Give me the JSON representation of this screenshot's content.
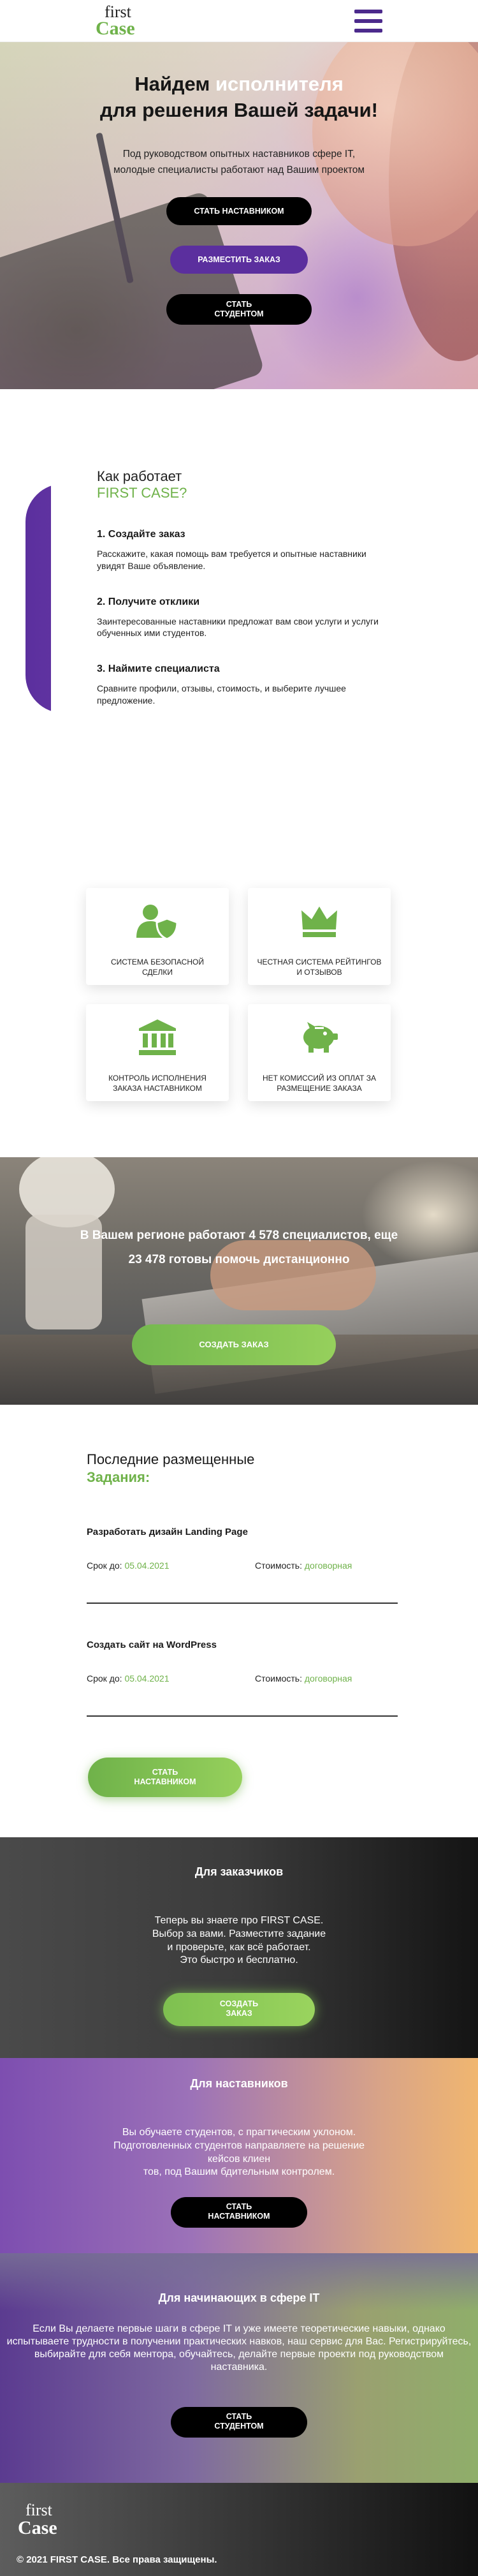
{
  "header": {
    "logo_line1": "first",
    "logo_line2": "Case"
  },
  "hero": {
    "title_part1": "Найдем ",
    "title_highlight": "исполнителя",
    "title_part2": " для решения Вашей задачи!",
    "subtitle": "Под руководством опытных наставников сфере IT, молодые специалисты работают над Вашим проектом",
    "btn_mentor": "СТАТЬ НАСТАВНИКОМ",
    "btn_order": "РАЗМЕСТИТЬ ЗАКАЗ",
    "btn_student_1": "СТАТЬ",
    "btn_student_2": "СТУДЕНТОМ"
  },
  "how": {
    "title": "Как работает",
    "title_brand": "FIRST CASE?",
    "steps": [
      {
        "title": "1. Создайте заказ",
        "text": "Расскажите, какая помощь вам требуется и опытные наставники увидят Ваше объявление."
      },
      {
        "title": "2. Получите отклики",
        "text": "Заинтересованные наставники предложат вам свои услуги и услуги обученных ими студентов."
      },
      {
        "title": "3. Наймите специалиста",
        "text": "Сравните профили, отзывы, стоимость, и выберите лучшее предложение."
      }
    ]
  },
  "features": [
    {
      "label": "СИСТЕМА БЕЗОПАСНОЙ СДЕЛКИ",
      "icon": "user-shield-icon"
    },
    {
      "label": "ЧЕСТНАЯ СИСТЕМА РЕЙТИНГОВ И ОТЗЫВОВ",
      "icon": "crown-icon"
    },
    {
      "label": "КОНТРОЛЬ ИСПОЛНЕНИЯ ЗАКАЗА НАСТАВНИКОМ",
      "icon": "bank-icon"
    },
    {
      "label": "НЕТ КОМИССИЙ ИЗ ОПЛАТ ЗА РАЗМЕЩЕНИЕ ЗАКАЗА",
      "icon": "piggy-bank-icon"
    }
  ],
  "stats": {
    "line1": "В Вашем регионе работают 4 578 специалистов, еще",
    "line2": "23 478 готовы помочь дистанционно",
    "cta": "СОЗДАТЬ ЗАКАЗ"
  },
  "tasks": {
    "title": "Последние размещенные",
    "title_green": "Задания:",
    "items": [
      {
        "title": "Разработать дизайн Landing Page",
        "deadline_label": "Срок до: ",
        "deadline": "05.04.2021",
        "cost_label": "Стоимость: ",
        "cost": "договорная"
      },
      {
        "title": "Создать сайт на WordPress",
        "deadline_label": "Срок до: ",
        "deadline": "05.04.2021",
        "cost_label": "Стоимость: ",
        "cost": "договорная"
      }
    ],
    "cta_1": "СТАТЬ",
    "cta_2": "НАСТАВНИКОМ"
  },
  "customers": {
    "title": "Для заказчиков",
    "lines": [
      "Теперь вы знаете про FIRST CASE.",
      "Выбор за вами. Разместите задание",
      "и проверьте, как всё работает.",
      "Это быстро и бесплатно."
    ],
    "cta_1": "СОЗДАТЬ",
    "cta_2": "ЗАКАЗ"
  },
  "mentors": {
    "title": "Для наставников",
    "lines": [
      "Вы обучаете студентов, с прагтическим уклоном.",
      "Подготовленных студентов направляете на решение",
      "кейсов клиен",
      "тов, под Вашим бдительным контролем."
    ],
    "cta_1": "СТАТЬ",
    "cta_2": "НАСТАВНИКОМ"
  },
  "beginners": {
    "title": "Для начинающих в сфере IT",
    "text": "Если Вы делаете первые шаги в сфере IT и уже имеете теоретические навыки, однако испытываете трудности в получении прaктических навков, наш сервис для Вас. Регистрируйтесь, выбирайте для себя ментора, обучайтесь, делайте первые проекти под руководством наставника.",
    "cta_1": "СТАТЬ",
    "cta_2": "СТУДЕНТОМ"
  },
  "footer": {
    "logo_line1": "first",
    "logo_line2": "Case",
    "copyright": "© 2021 FIRST CASE. Все права защищены."
  },
  "colors": {
    "brand_green": "#6fb24a",
    "brand_purple": "#5b2f9e",
    "dark": "#000000"
  }
}
